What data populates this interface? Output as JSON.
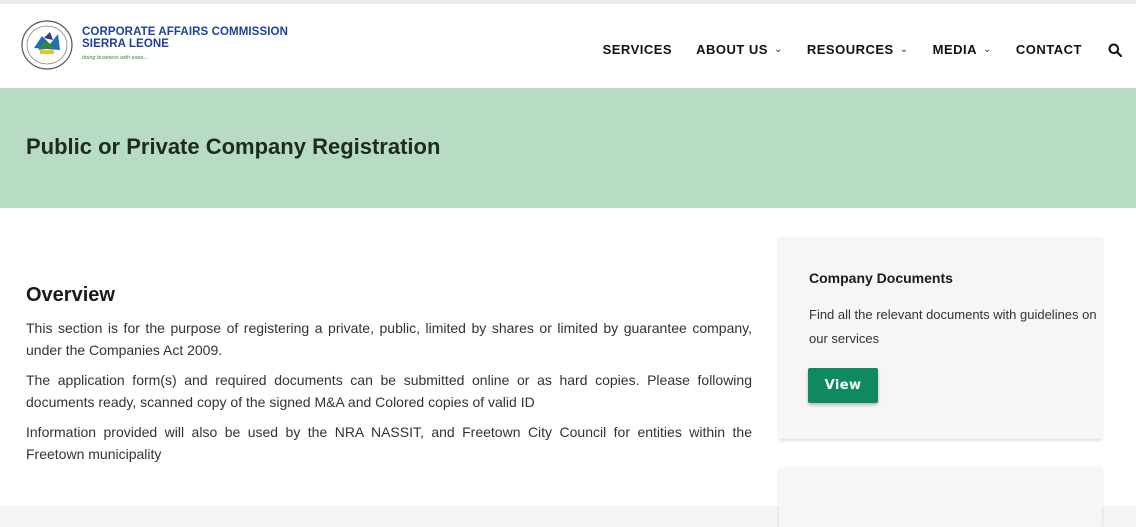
{
  "header": {
    "logo_line1": "CORPORATE AFFAIRS COMMISSION",
    "logo_line2": "SIERRA LEONE",
    "logo_tagline": "doing business with ease...",
    "nav": [
      {
        "label": "SERVICES"
      },
      {
        "label": "ABOUT US"
      },
      {
        "label": "RESOURCES"
      },
      {
        "label": "MEDIA"
      },
      {
        "label": "CONTACT"
      }
    ],
    "caret": "⌄"
  },
  "hero": {
    "title": "Public or Private Company Registration",
    "background": "#b7dcc3"
  },
  "overview": {
    "heading": "Overview",
    "paragraphs": [
      "This section is for the purpose of registering a private, public, limited by shares or limited by guarantee company, under the Companies Act 2009.",
      "The application form(s) and required documents can be submitted online or as hard copies. Please following documents ready, scanned copy of the signed M&A and Colored copies of valid ID",
      "Information provided will also be used by the NRA NASSIT, and Freetown City Council for entities within the Freetown municipality"
    ]
  },
  "sidebar": {
    "card_title": "Company Documents",
    "card_text": "Find all the relevant documents with guidelines on our services",
    "view_label": "View",
    "accent": "#0f8a5f"
  },
  "icons": {
    "search": "search-icon",
    "logo": "commission-emblem-icon"
  }
}
